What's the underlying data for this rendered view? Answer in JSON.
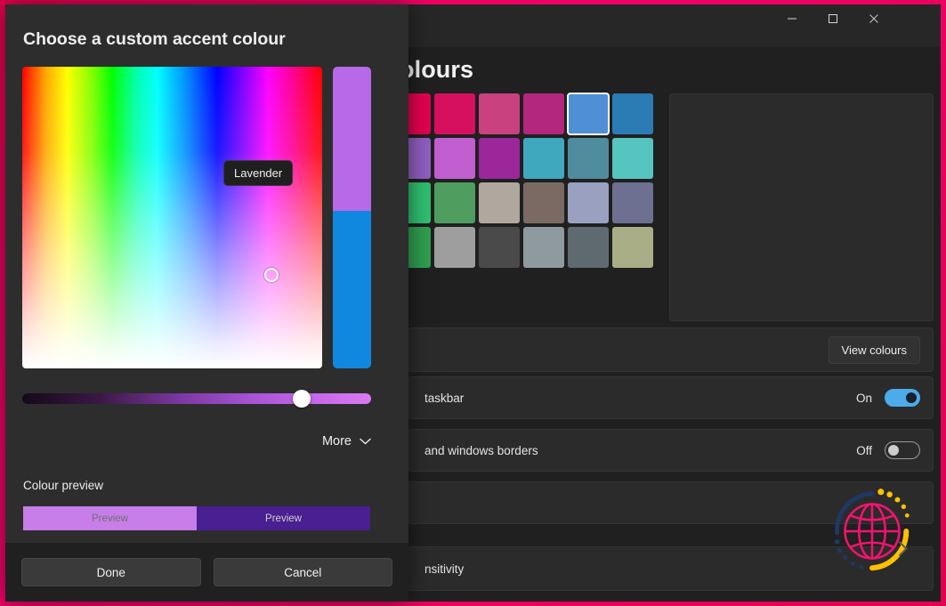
{
  "frame": {
    "accent_colour": "#e8115b"
  },
  "settings_window": {
    "heading": "olours",
    "full_heading": "Windows colours",
    "window_controls": [
      {
        "name": "minimise",
        "glyph": "—"
      },
      {
        "name": "maximise",
        "glyph": "□"
      },
      {
        "name": "close",
        "glyph": "✕"
      }
    ],
    "swatches": [
      [
        "#e3004f",
        "#d6105f",
        "#c9417f",
        "#b4277f",
        "#4f8fd6",
        "#2b7cb5",
        null
      ],
      [
        "#8f5fbf",
        "#c15fd0",
        "#9b279b",
        "#3fa8bf",
        "#4f8c9e",
        "#57c5bf",
        null
      ],
      [
        "#2fbf6f",
        "#4f9e5f",
        "#b0a79f",
        "#7a6a63",
        "#9aa0bf",
        "#6d7090",
        null
      ],
      [
        "#2f9e4f",
        "#9e9e9e",
        "#4a4a4a",
        "#8e9a9e",
        "#5e6a6f",
        "#a9ae86",
        null
      ]
    ],
    "selected_swatch": {
      "row": 0,
      "col": 4,
      "colour": "#4f8fd6"
    },
    "rows": [
      {
        "id": "view-colours",
        "label": "",
        "button": "View colours"
      },
      {
        "id": "taskbar",
        "label": "taskbar",
        "state": "On",
        "toggle": "on"
      },
      {
        "id": "borders",
        "label": "and windows borders",
        "state": "Off",
        "toggle": "off"
      },
      {
        "id": "transparency",
        "label": "",
        "state": ""
      },
      {
        "id": "sensitivity",
        "label": "nsitivity",
        "state": ""
      }
    ],
    "watermark": {
      "name": "globe-logo",
      "globe_colour": "#f2136f",
      "arc_navy": "#1f3864",
      "arc_yellow": "#ffc000"
    }
  },
  "colour_dialog": {
    "title": "Choose a custom accent colour",
    "tooltip": "Lavender",
    "vertical_strip": {
      "top_colour": "#b769e8",
      "bottom_colour": "#1188e0"
    },
    "brightness": {
      "value_percent": 80,
      "thumb_colour": "#ffffff"
    },
    "more_button": {
      "label": "More",
      "icon": "chevron-down-icon"
    },
    "preview": {
      "label": "Colour preview",
      "left": {
        "text": "Preview",
        "bg": "#c77ee8",
        "fg": "#6f6f6f"
      },
      "right": {
        "text": "Preview",
        "bg": "#4a1f91",
        "fg": "#cfcfcf"
      }
    },
    "footer": {
      "done": "Done",
      "cancel": "Cancel"
    }
  }
}
